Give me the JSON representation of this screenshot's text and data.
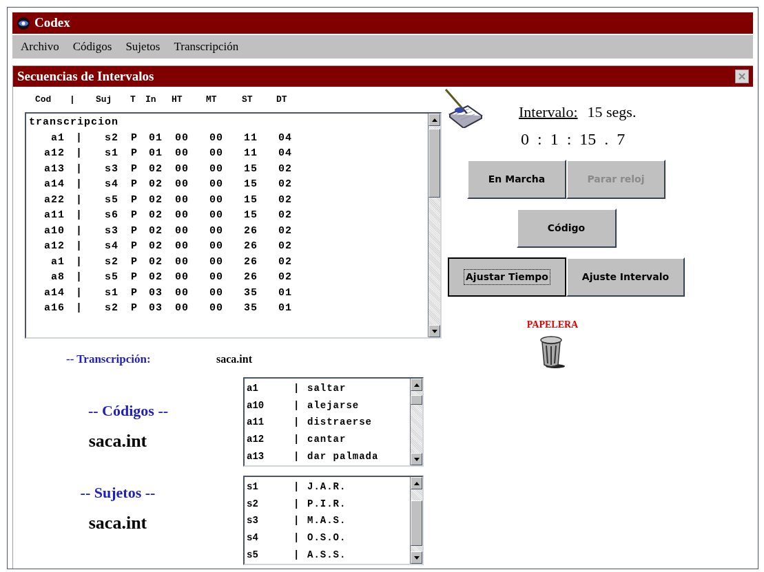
{
  "window": {
    "title": "Codex"
  },
  "menu": [
    {
      "label": "Archivo"
    },
    {
      "label": "Códigos"
    },
    {
      "label": "Sujetos"
    },
    {
      "label": "Transcripción"
    }
  ],
  "dialog": {
    "title": "Secuencias de Intervalos"
  },
  "sequence_list": {
    "columns": [
      "Cod",
      "|",
      "Suj",
      "T",
      "In",
      "HT",
      "MT",
      "ST",
      "DT"
    ],
    "rows": [
      {
        "kind": "group",
        "text": "transcripcion"
      },
      {
        "kind": "data",
        "cells": [
          "a1",
          "|",
          "s2",
          "P",
          "01",
          "00",
          "00",
          "11",
          "04"
        ]
      },
      {
        "kind": "data",
        "cells": [
          "a12",
          "|",
          "s1",
          "P",
          "01",
          "00",
          "00",
          "11",
          "04"
        ]
      },
      {
        "kind": "data",
        "cells": [
          "a13",
          "|",
          "s3",
          "P",
          "02",
          "00",
          "00",
          "15",
          "02"
        ]
      },
      {
        "kind": "data",
        "cells": [
          "a14",
          "|",
          "s4",
          "P",
          "02",
          "00",
          "00",
          "15",
          "02"
        ]
      },
      {
        "kind": "data",
        "cells": [
          "a22",
          "|",
          "s5",
          "P",
          "02",
          "00",
          "00",
          "15",
          "02"
        ]
      },
      {
        "kind": "data",
        "cells": [
          "a11",
          "|",
          "s6",
          "P",
          "02",
          "00",
          "00",
          "15",
          "02"
        ]
      },
      {
        "kind": "data",
        "cells": [
          "a10",
          "|",
          "s3",
          "P",
          "02",
          "00",
          "00",
          "26",
          "02"
        ]
      },
      {
        "kind": "data",
        "cells": [
          "a12",
          "|",
          "s4",
          "P",
          "02",
          "00",
          "00",
          "26",
          "02"
        ]
      },
      {
        "kind": "data",
        "cells": [
          "a1",
          "|",
          "s2",
          "P",
          "02",
          "00",
          "00",
          "26",
          "02"
        ]
      },
      {
        "kind": "data",
        "cells": [
          "a8",
          "|",
          "s5",
          "P",
          "02",
          "00",
          "00",
          "26",
          "02"
        ]
      },
      {
        "kind": "data",
        "cells": [
          "a14",
          "|",
          "s1",
          "P",
          "03",
          "00",
          "00",
          "35",
          "01"
        ]
      },
      {
        "kind": "data",
        "cells": [
          "a16",
          "|",
          "s2",
          "P",
          "03",
          "00",
          "00",
          "35",
          "01"
        ]
      }
    ]
  },
  "interval": {
    "label": "Intervalo:",
    "value": "15 segs."
  },
  "clock": "0 : 1 : 15 . 7",
  "button_rows": [
    [
      {
        "label": "En Marcha",
        "disabled": false,
        "focused": false
      },
      {
        "label": "Parar reloj",
        "disabled": true,
        "focused": false
      }
    ],
    [
      {
        "label": "Código",
        "disabled": false,
        "focused": false
      }
    ],
    [
      {
        "label": "Ajustar Tiempo",
        "disabled": false,
        "focused": true
      },
      {
        "label": "Ajuste Intervalo",
        "disabled": false,
        "focused": false
      }
    ]
  ],
  "trash": {
    "label": "PAPELERA"
  },
  "transcription": {
    "label": "-- Transcripción:",
    "file": "saca.int"
  },
  "codes": {
    "label": "-- Códigos --",
    "file": "saca.int",
    "items": [
      [
        "a1",
        "|",
        "saltar"
      ],
      [
        "a10",
        "|",
        "alejarse"
      ],
      [
        "a11",
        "|",
        "distraerse"
      ],
      [
        "a12",
        "|",
        "cantar"
      ],
      [
        "a13",
        "|",
        "dar palmada"
      ]
    ]
  },
  "subjects": {
    "label": "-- Sujetos --",
    "file": "saca.int",
    "items": [
      [
        "s1",
        "|",
        "J.A.R."
      ],
      [
        "s2",
        "|",
        "P.I.R."
      ],
      [
        "s3",
        "|",
        "M.A.S."
      ],
      [
        "s4",
        "|",
        "O.S.O."
      ],
      [
        "s5",
        "|",
        "A.S.S."
      ]
    ]
  }
}
